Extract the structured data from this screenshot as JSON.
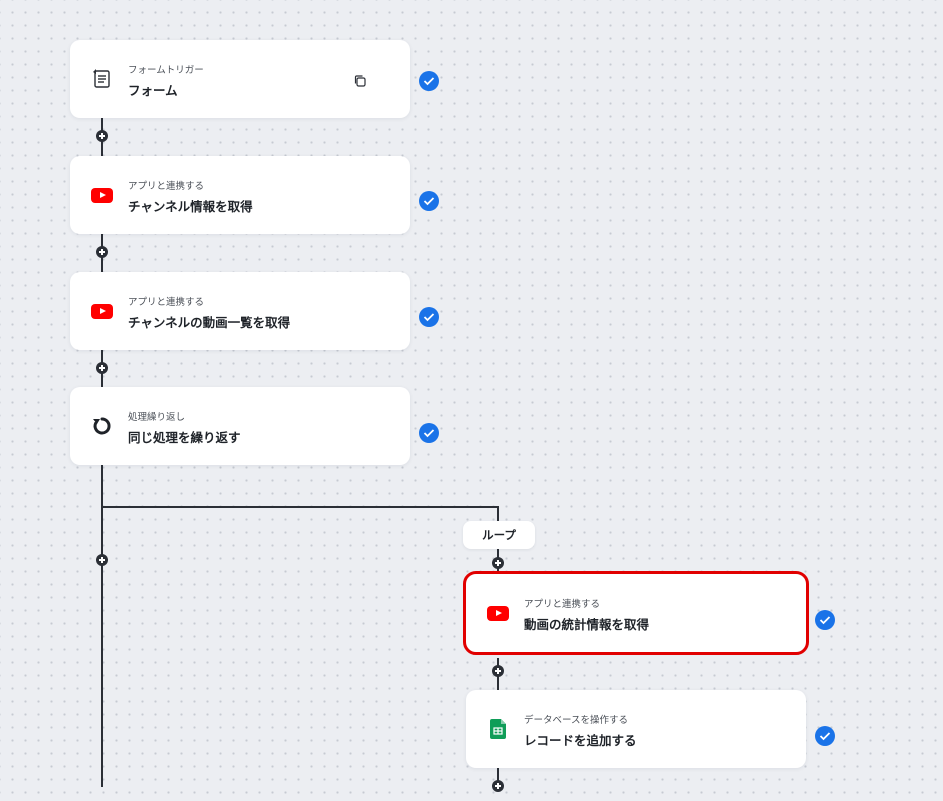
{
  "nodes": [
    {
      "subtitle": "フォームトリガー",
      "title": "フォーム",
      "icon": "form-trigger-icon",
      "has_copy": true,
      "status": "completed"
    },
    {
      "subtitle": "アプリと連携する",
      "title": "チャンネル情報を取得",
      "icon": "youtube-icon",
      "status": "completed"
    },
    {
      "subtitle": "アプリと連携する",
      "title": "チャンネルの動画一覧を取得",
      "icon": "youtube-icon",
      "status": "completed"
    },
    {
      "subtitle": "処理繰り返し",
      "title": "同じ処理を繰り返す",
      "icon": "loop-icon",
      "status": "completed"
    }
  ],
  "loop": {
    "label": "ループ",
    "nodes": [
      {
        "subtitle": "アプリと連携する",
        "title": "動画の統計情報を取得",
        "icon": "youtube-icon",
        "status": "completed",
        "highlighted": true
      },
      {
        "subtitle": "データベースを操作する",
        "title": "レコードを追加する",
        "icon": "google-sheets-icon",
        "status": "completed"
      }
    ]
  },
  "colors": {
    "background": "#eceef2",
    "card": "#ffffff",
    "check_badge": "#1a73e8",
    "highlight_border": "#e10000",
    "youtube_red": "#ff0000",
    "sheets_green": "#0f9d58",
    "connector": "#2b2f36"
  }
}
